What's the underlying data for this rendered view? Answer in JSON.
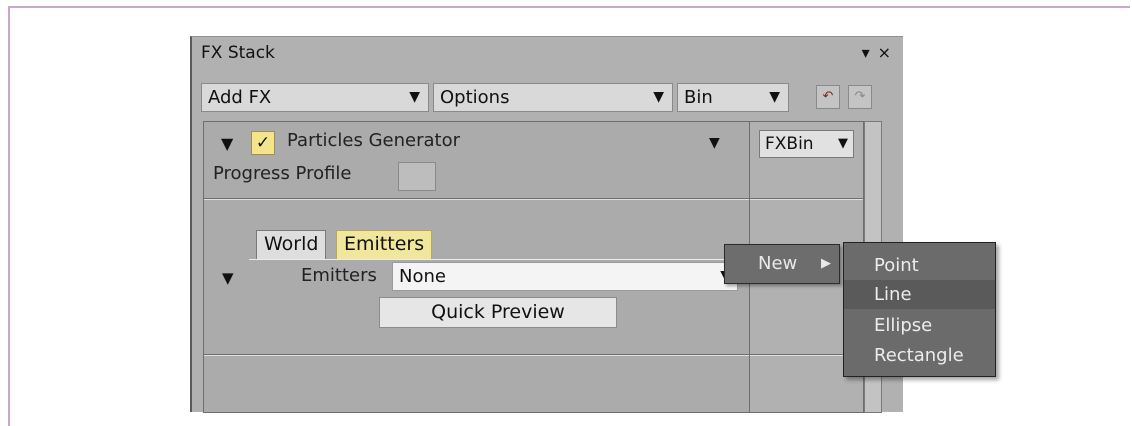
{
  "panel": {
    "title": "FX Stack",
    "title_buttons": {
      "menu": "▾",
      "close": "×"
    }
  },
  "toolbar": {
    "add_fx": "Add FX",
    "options": "Options",
    "bin": "Bin"
  },
  "fx_item": {
    "name": "Particles Generator",
    "enabled": true,
    "progress_profile_label": "Progress Profile"
  },
  "tabs": [
    {
      "label": "World",
      "active": false
    },
    {
      "label": "Emitters",
      "active": true
    }
  ],
  "emitters_row": {
    "label": "Emitters",
    "value": "None"
  },
  "quick_preview_label": "Quick Preview",
  "bin_column": {
    "button_label": "FXBin"
  },
  "context_menu": {
    "item": "New",
    "submenu": [
      {
        "label": "Point",
        "highlighted": false
      },
      {
        "label": "Line",
        "highlighted": true
      },
      {
        "label": "Ellipse",
        "highlighted": false
      },
      {
        "label": "Rectangle",
        "highlighted": false
      }
    ]
  },
  "icons": {
    "expand": "triangle-down-icon",
    "check": "checkmark-icon",
    "undo": "undo-icon",
    "redo": "redo-icon"
  },
  "colors": {
    "panel_bg": "#b1b1b1",
    "checkbox_bg": "#f4e58a",
    "active_tab_bg": "#f1e79c",
    "menu_bg": "#6b6b6b",
    "frame_border": "#c9a6cc"
  }
}
